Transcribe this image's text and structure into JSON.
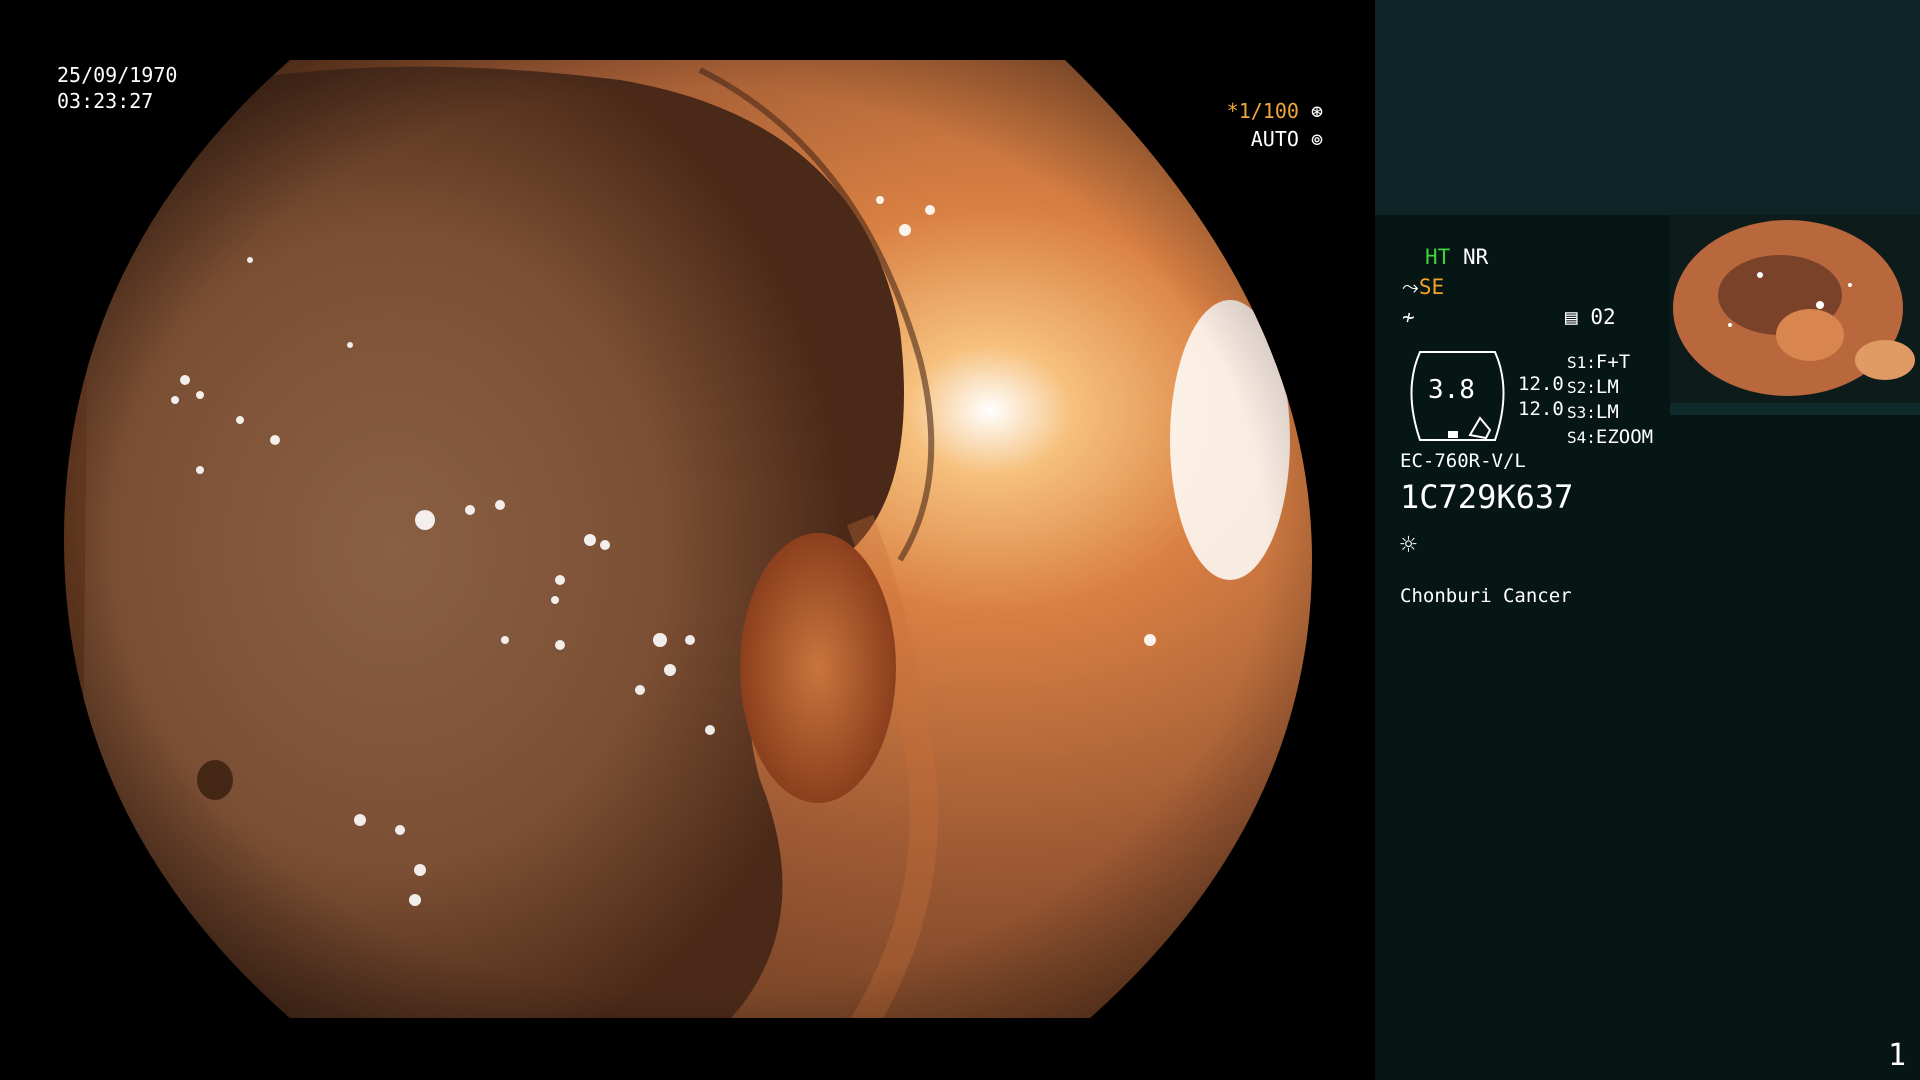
{
  "scope": {
    "date": "25/09/1970",
    "time": "03:23:27",
    "shutter": "*1/100",
    "shutter_icon": "shutter-icon",
    "iris": "AUTO",
    "iris_icon": "iris-icon"
  },
  "panel": {
    "ht": "HT",
    "nr": "NR",
    "se": "SE",
    "se_icon": "scope-tip-icon",
    "enhance_icon": "enhance-icon",
    "memory_icon": "memory-card-icon",
    "memory_count": "02",
    "gauge_value": "3.8",
    "gauge_lines": [
      "12.0",
      "12.0"
    ],
    "switches": [
      {
        "key": "S1:",
        "value": "F+T"
      },
      {
        "key": "S2:",
        "value": "LM"
      },
      {
        "key": "S3:",
        "value": "LM"
      },
      {
        "key": "S4:",
        "value": "EZOOM"
      }
    ],
    "scope_model": "EC-760R-V/L",
    "serial": "1C729K637",
    "light_icon": "sun-icon",
    "hospital": "Chonburi Cancer",
    "page_number": "1"
  },
  "colors": {
    "panel_bg": "#061614",
    "panel_top": "#0e2426",
    "ht_green": "#3fd23c",
    "se_orange": "#f5a22a",
    "shutter_orange": "#f0a63a",
    "mucosa": "#a45d38"
  }
}
